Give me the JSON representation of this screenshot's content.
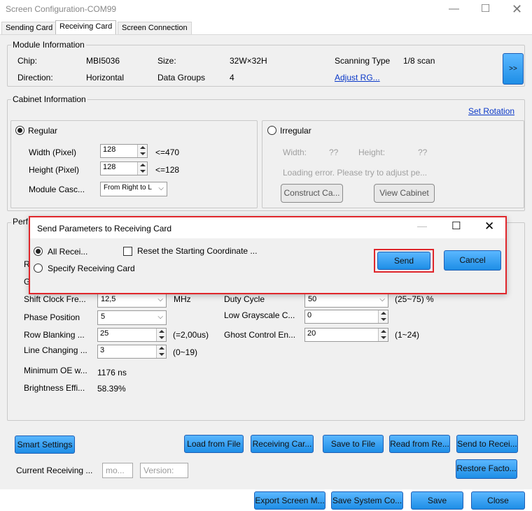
{
  "window": {
    "title": "Screen Configuration-COM99"
  },
  "tabs": [
    "Sending Card",
    "Receiving Card",
    "Screen Connection"
  ],
  "module": {
    "title": "Module Information",
    "chip_label": "Chip:",
    "chip_value": "MBI5036",
    "size_label": "Size:",
    "size_value": "32W×32H",
    "scan_label": "Scanning Type",
    "scan_value": "1/8 scan",
    "direction_label": "Direction:",
    "direction_value": "Horizontal",
    "groups_label": "Data Groups",
    "groups_value": "4",
    "adjust_link": "Adjust RG...",
    "more_button": ">>"
  },
  "cabinet": {
    "title": "Cabinet Information",
    "set_rotation": "Set Rotation",
    "regular_label": "Regular",
    "width_label": "Width (Pixel)",
    "width_value": "128",
    "width_hint": "<=470",
    "height_label": "Height (Pixel)",
    "height_value": "128",
    "height_hint": "<=128",
    "cascade_label": "Module Casc...",
    "cascade_value": "From Right to L",
    "irregular_label": "Irregular",
    "irr_width_label": "Width:",
    "irr_width_value": "??",
    "irr_height_label": "Height:",
    "irr_height_value": "??",
    "loading_error": "Loading error. Please try to adjust pe...",
    "construct_button": "Construct Ca...",
    "view_button": "View Cabinet"
  },
  "performance": {
    "title": "Perf",
    "partial_r": "R",
    "partial_g": "G",
    "shift_label": "Shift Clock Fre...",
    "shift_value": "12,5",
    "shift_unit": "MHz",
    "duty_label": "Duty Cycle",
    "duty_value": "50",
    "duty_hint": "(25~75) %",
    "phase_label": "Phase Position",
    "phase_value": "5",
    "low_gray_label": "Low Grayscale C...",
    "low_gray_value": "0",
    "row_label": "Row Blanking ...",
    "row_value": "25",
    "row_hint": "(=2,00us)",
    "ghost_label": "Ghost Control En...",
    "ghost_value": "20",
    "ghost_hint": "(1~24)",
    "line_label": "Line Changing ...",
    "line_value": "3",
    "line_hint": "(0~19)",
    "min_oe_label": "Minimum OE w...",
    "min_oe_value": "1176 ns",
    "brightness_label": "Brightness Effi...",
    "brightness_value": "58.39%"
  },
  "actions": {
    "smart": "Smart Settings",
    "load": "Load from File",
    "receiving": "Receiving Car...",
    "save_file": "Save to File",
    "read": "Read from Re...",
    "send_to": "Send to Recei...",
    "restore": "Restore Facto...",
    "current_label": "Current Receiving ...",
    "model_placeholder": "mo...",
    "version_placeholder": "Version:"
  },
  "footer": {
    "export": "Export Screen M...",
    "save_system": "Save System Co...",
    "save": "Save",
    "close": "Close"
  },
  "dialog": {
    "title": "Send Parameters to Receiving Card",
    "all_label": "All Recei...",
    "reset_label": "Reset the Starting Coordinate ...",
    "specify_label": "Specify Receiving Card",
    "send": "Send",
    "cancel": "Cancel"
  },
  "icons": {
    "minimize": "minimize-icon",
    "maximize": "maximize-icon",
    "close": "close-icon",
    "dropdown": "chevron-down-icon"
  },
  "colors": {
    "accent_button": "#1e8ee6",
    "highlight": "#e0262b",
    "link": "#0a38c8"
  }
}
